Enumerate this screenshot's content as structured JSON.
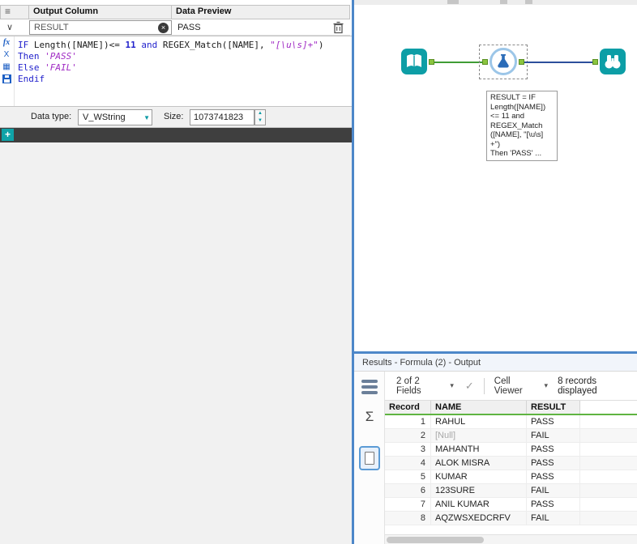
{
  "icons": {
    "reorder": "≡",
    "expand": "∨",
    "clear": "×",
    "dropdown": "▼",
    "spin_up": "▲",
    "spin_down": "▼",
    "caret_down": "▾",
    "check": "✓",
    "sigma": "Σ",
    "functions": "fx",
    "variables": "X",
    "constants": "▦",
    "add": "+"
  },
  "formula_panel": {
    "columns": {
      "output": "Output Column",
      "preview": "Data Preview"
    },
    "expression": {
      "output_value": "RESULT",
      "preview_value": "PASS"
    },
    "editor_lines": [
      [
        {
          "t": "IF ",
          "c": "kw"
        },
        {
          "t": "Length([NAME])<= ",
          "c": "pl"
        },
        {
          "t": "11",
          "c": "num"
        },
        {
          "t": " ",
          "c": "pl"
        },
        {
          "t": "and",
          "c": "kw"
        },
        {
          "t": " REGEX_Match([NAME], ",
          "c": "pl"
        },
        {
          "t": "\"[\\u\\s]+\"",
          "c": "str"
        },
        {
          "t": ")",
          "c": "pl"
        }
      ],
      [
        {
          "t": "Then ",
          "c": "kw"
        },
        {
          "t": "'PASS'",
          "c": "str"
        }
      ],
      [
        {
          "t": "Else ",
          "c": "kw"
        },
        {
          "t": "'FAIL'",
          "c": "str"
        }
      ],
      [
        {
          "t": "Endif",
          "c": "kw"
        }
      ]
    ],
    "data_type": {
      "label": "Data type:",
      "value": "V_WString"
    },
    "size": {
      "label": "Size:",
      "value": "1073741823"
    }
  },
  "canvas": {
    "tools": [
      {
        "name": "input-data-tool"
      },
      {
        "name": "formula-tool"
      },
      {
        "name": "browse-tool"
      }
    ],
    "annotation_lines": [
      "RESULT = IF",
      "Length([NAME])",
      "<= 11 and",
      "REGEX_Match",
      "([NAME], \"[\\u\\s]",
      "+\")",
      "Then 'PASS' ..."
    ]
  },
  "results": {
    "title": "Results - Formula (2) - Output",
    "toolbar": {
      "fields": "2 of 2 Fields",
      "cell_viewer": "Cell Viewer",
      "records": "8 records displayed"
    },
    "table": {
      "columns": [
        "Record",
        "NAME",
        "RESULT"
      ],
      "rows": [
        [
          "1",
          "RAHUL",
          "PASS"
        ],
        [
          "2",
          "[Null]",
          "FAIL"
        ],
        [
          "3",
          "MAHANTH",
          "PASS"
        ],
        [
          "4",
          "ALOK MISRA",
          "PASS"
        ],
        [
          "5",
          "KUMAR",
          "PASS"
        ],
        [
          "6",
          "123SURE",
          "FAIL"
        ],
        [
          "7",
          "ANIL KUMAR",
          "PASS"
        ],
        [
          "8",
          "AQZWSXEDCRFV",
          "FAIL"
        ]
      ]
    }
  }
}
